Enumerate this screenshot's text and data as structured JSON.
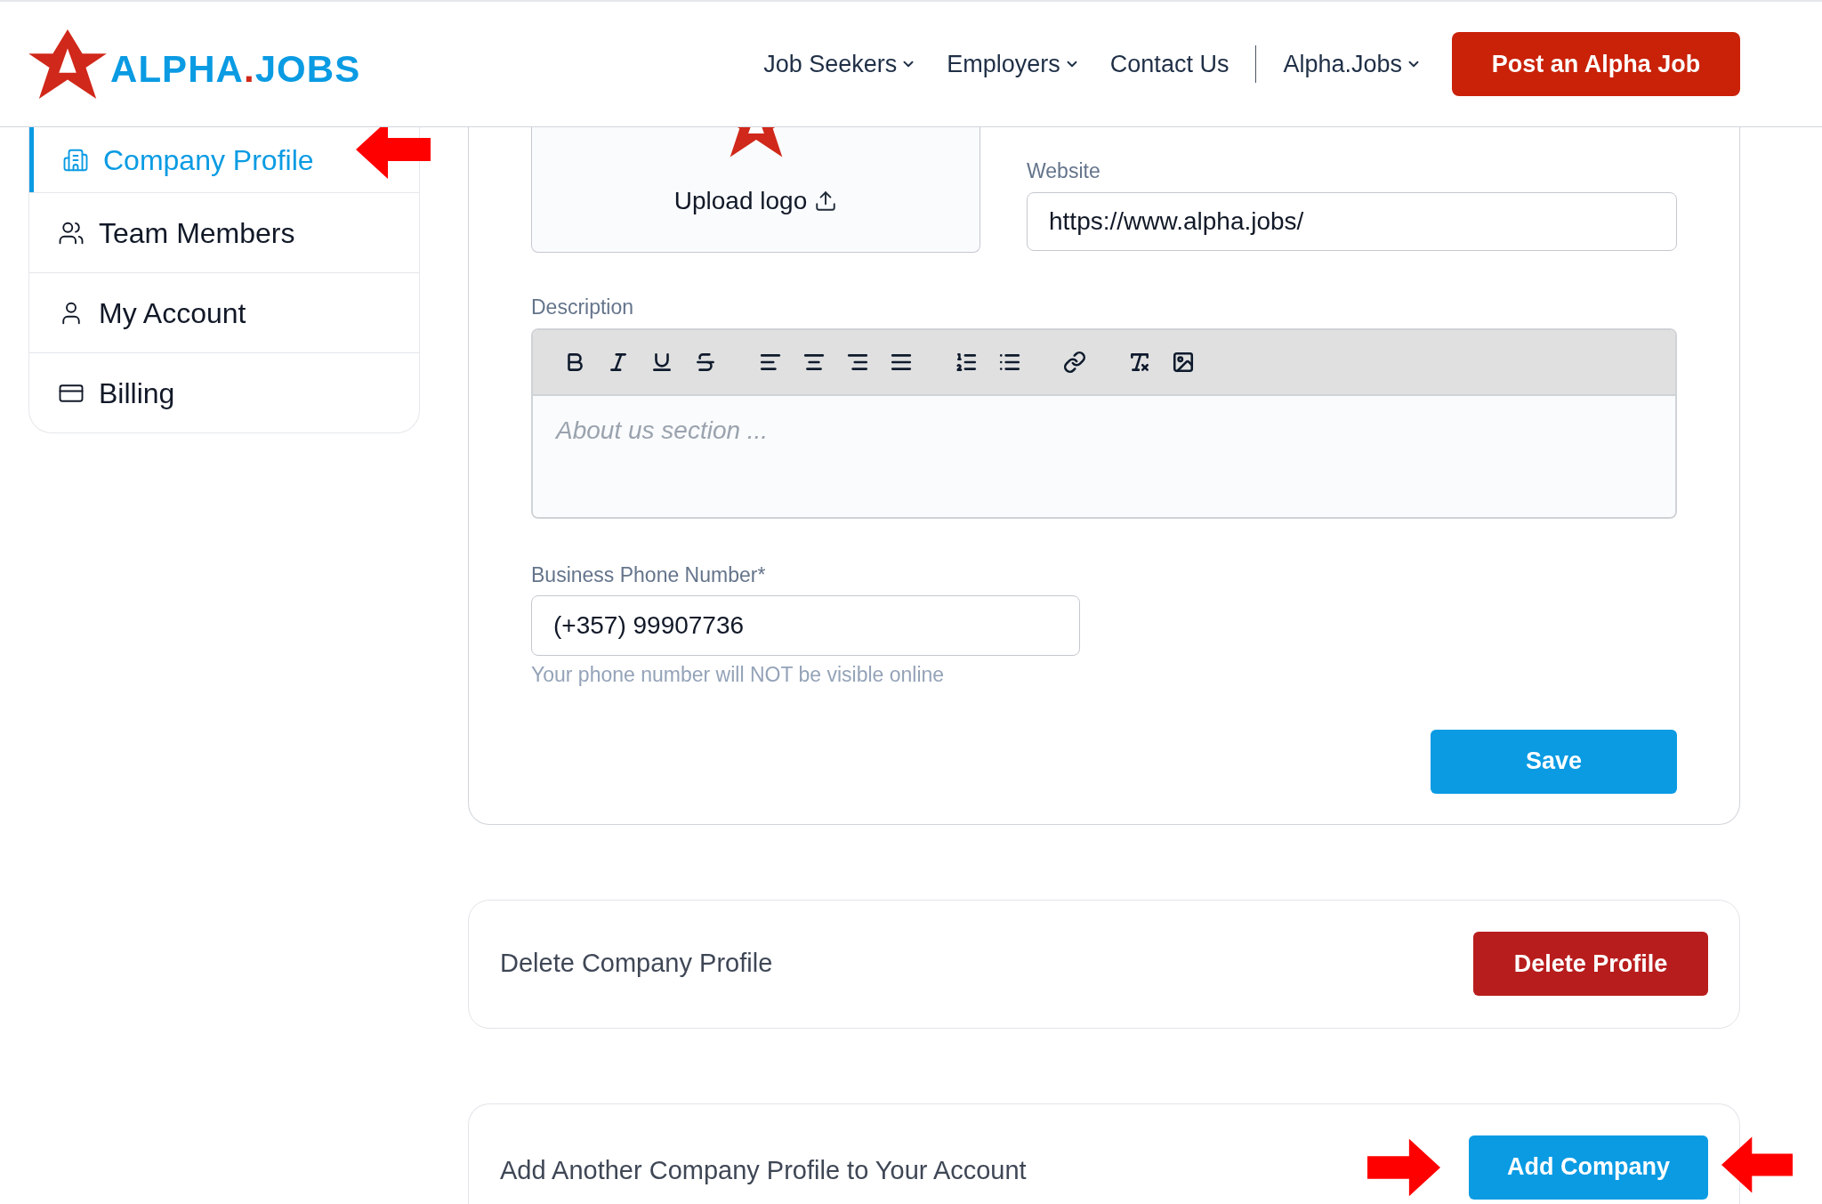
{
  "header": {
    "logo": {
      "part_1": "ALPHA",
      "dot": ".",
      "part_2": "JOBS"
    },
    "nav": [
      {
        "label": "Job Seekers",
        "dropdown": true
      },
      {
        "label": "Employers",
        "dropdown": true
      },
      {
        "label": "Contact Us",
        "dropdown": false
      },
      {
        "label": "Alpha.Jobs",
        "dropdown": true
      }
    ],
    "cta": "Post an Alpha Job"
  },
  "sidebar": {
    "items": [
      {
        "label": "Company Profile",
        "selected": true
      },
      {
        "label": "Team Members",
        "selected": false
      },
      {
        "label": "My Account",
        "selected": false
      },
      {
        "label": "Billing",
        "selected": false
      }
    ]
  },
  "profile_form": {
    "upload_logo": "Upload logo",
    "website": {
      "label": "Website",
      "value": "https://www.alpha.jobs/"
    },
    "description": {
      "label": "Description",
      "placeholder": "About us section ..."
    },
    "phone": {
      "label": "Business Phone Number*",
      "value": "(+357) 99907736",
      "hint": "Your phone number will NOT be visible online"
    },
    "save": "Save"
  },
  "delete_section": {
    "title": "Delete Company Profile",
    "button": "Delete Profile"
  },
  "add_section": {
    "title": "Add Another Company Profile to Your Account",
    "button": "Add Company"
  }
}
